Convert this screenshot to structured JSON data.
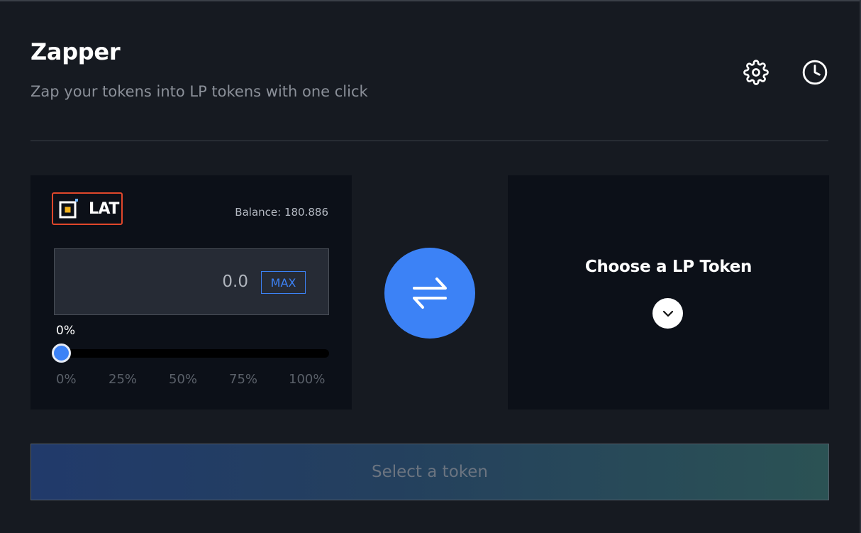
{
  "header": {
    "title": "Zapper",
    "subtitle": "Zap your tokens into LP tokens with one click",
    "settings_icon": "gear-icon",
    "history_icon": "clock-icon"
  },
  "from": {
    "token_symbol": "LAT",
    "token_icon": "lat-token-icon",
    "balance_label": "Balance:",
    "balance_value": "180.886",
    "amount_value": "0.0",
    "max_label": "MAX",
    "percent_current": "0%",
    "percent_value": 0,
    "percent_ticks": [
      "0%",
      "25%",
      "50%",
      "75%",
      "100%"
    ]
  },
  "swap_icon": "swap-arrows-icon",
  "to": {
    "choose_label": "Choose a LP Token",
    "chevron_icon": "chevron-down-icon"
  },
  "action": {
    "label": "Select a token"
  },
  "colors": {
    "accent": "#3c82f6",
    "background": "#161a21",
    "card": "#0c1018",
    "highlight_border": "#e0472b"
  }
}
